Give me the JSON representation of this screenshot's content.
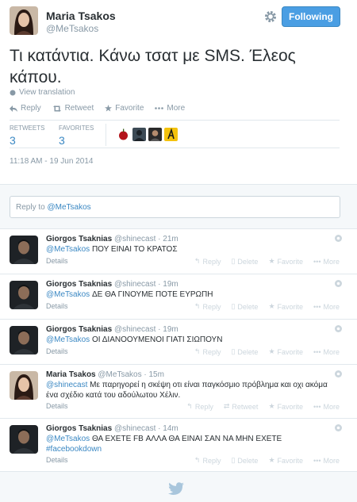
{
  "tweet": {
    "author_name": "Maria Tsakos",
    "author_handle": "@MeTsakos",
    "follow_label": "Following",
    "text": "Τι κατάντια. Κάνω τσατ με SMS. Έλεος κάπου.",
    "view_translation": "View translation",
    "actions": {
      "reply": "Reply",
      "retweet": "Retweet",
      "favorite": "Favorite",
      "more": "More"
    },
    "stats": {
      "retweets_label": "RETWEETS",
      "retweets": "3",
      "favorites_label": "FAVORITES",
      "favorites": "3"
    },
    "timestamp": "11:18 AM - 19 Jun 2014"
  },
  "reply_box": {
    "prefix": "Reply to ",
    "mention": "@MeTsakos"
  },
  "reply_actions": {
    "reply": "Reply",
    "delete": "Delete",
    "retweet": "Retweet",
    "favorite": "Favorite",
    "more": "More",
    "details": "Details"
  },
  "replies": [
    {
      "name": "Giorgos Tsaknias",
      "handle": "@shinecast",
      "time": "· 21m",
      "mention": "@MeTsakos",
      "text": " ΠΟΥ ΕΙΝΑΙ ΤΟ ΚΡΑΤΟΣ"
    },
    {
      "name": "Giorgos Tsaknias",
      "handle": "@shinecast",
      "time": "· 19m",
      "mention": "@MeTsakos",
      "text": " ΔΕ ΘΑ ΓΙΝΟΥΜΕ ΠΟΤΕ ΕΥΡΩΠΗ"
    },
    {
      "name": "Giorgos Tsaknias",
      "handle": "@shinecast",
      "time": "· 19m",
      "mention": "@MeTsakos",
      "text": " ΟΙ ΔΙΑΝΟΟΥΜΕΝΟΙ ΓΙΑΤΙ ΣΙΩΠΟΥΝ"
    },
    {
      "name": "Maria Tsakos",
      "handle": "@MeTsakos",
      "time": "· 15m",
      "mention": "@shinecast",
      "text": " Με παρηγορεί η σκέψη οτι είναι παγκόσμιο πρόβλημα και οχι ακόμα ένα σχέδιο κατά του αδούλωτου Χέλιν."
    },
    {
      "name": "Giorgos Tsaknias",
      "handle": "@shinecast",
      "time": "· 14m",
      "mention": "@MeTsakos",
      "text": " ΘΑ ΕΧΕΤΕ FB ΑΛΛΑ ΘΑ ΕΙΝΑΙ ΣΑΝ ΝΑ ΜΗΝ ΕΧΕΤΕ",
      "hashtag": "#facebookdown"
    }
  ],
  "colors": {
    "accent": "#3b88c3",
    "follow_bg": "#4a9ee3",
    "muted": "#8899a6",
    "text": "#292f33"
  }
}
